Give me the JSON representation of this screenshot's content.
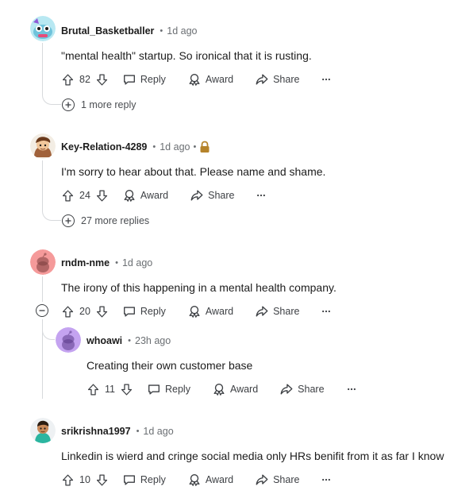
{
  "comments": [
    {
      "username": "Brutal_Basketballer",
      "time": "1d ago",
      "body": "\"mental health\" startup. So ironical that it is rusting.",
      "votes": "82",
      "actions": [
        "Reply",
        "Award",
        "Share"
      ],
      "more_replies": "1 more reply"
    },
    {
      "username": "Key-Relation-4289",
      "time": "1d ago",
      "body": "I'm sorry to hear about that. Please name and shame.",
      "votes": "24",
      "actions": [
        "Award",
        "Share"
      ],
      "more_replies": "27 more replies"
    },
    {
      "username": "rndm-nme",
      "time": "1d ago",
      "body": "The irony of this happening in a mental health company.",
      "votes": "20",
      "actions": [
        "Reply",
        "Award",
        "Share"
      ],
      "reply": {
        "username": "whoawi",
        "time": "23h ago",
        "body": "Creating their own customer base",
        "votes": "11",
        "actions": [
          "Reply",
          "Award",
          "Share"
        ]
      }
    },
    {
      "username": "srikrishna1997",
      "time": "1d ago",
      "body": "Linkedin is wierd and cringe social media only HRs benifit from it as far I know",
      "votes": "10",
      "actions": [
        "Reply",
        "Award",
        "Share"
      ]
    }
  ],
  "icons": {
    "upvote": "upvote-icon",
    "downvote": "downvote-icon",
    "reply": "reply-bubble-icon",
    "award": "award-ribbon-icon",
    "share": "share-arrow-icon",
    "more": "overflow-dots-icon",
    "lock": "lock-icon",
    "expand": "plus-circle-icon",
    "collapse": "minus-circle-icon"
  },
  "colors": {
    "text": "#1c1c1c",
    "meta": "#6b6f73",
    "thread_line": "#d7d9dc",
    "lock": "#b5832a",
    "avatar_snoo_red": "#f59a9a",
    "avatar_snoo_purple": "#c4a3f0"
  }
}
